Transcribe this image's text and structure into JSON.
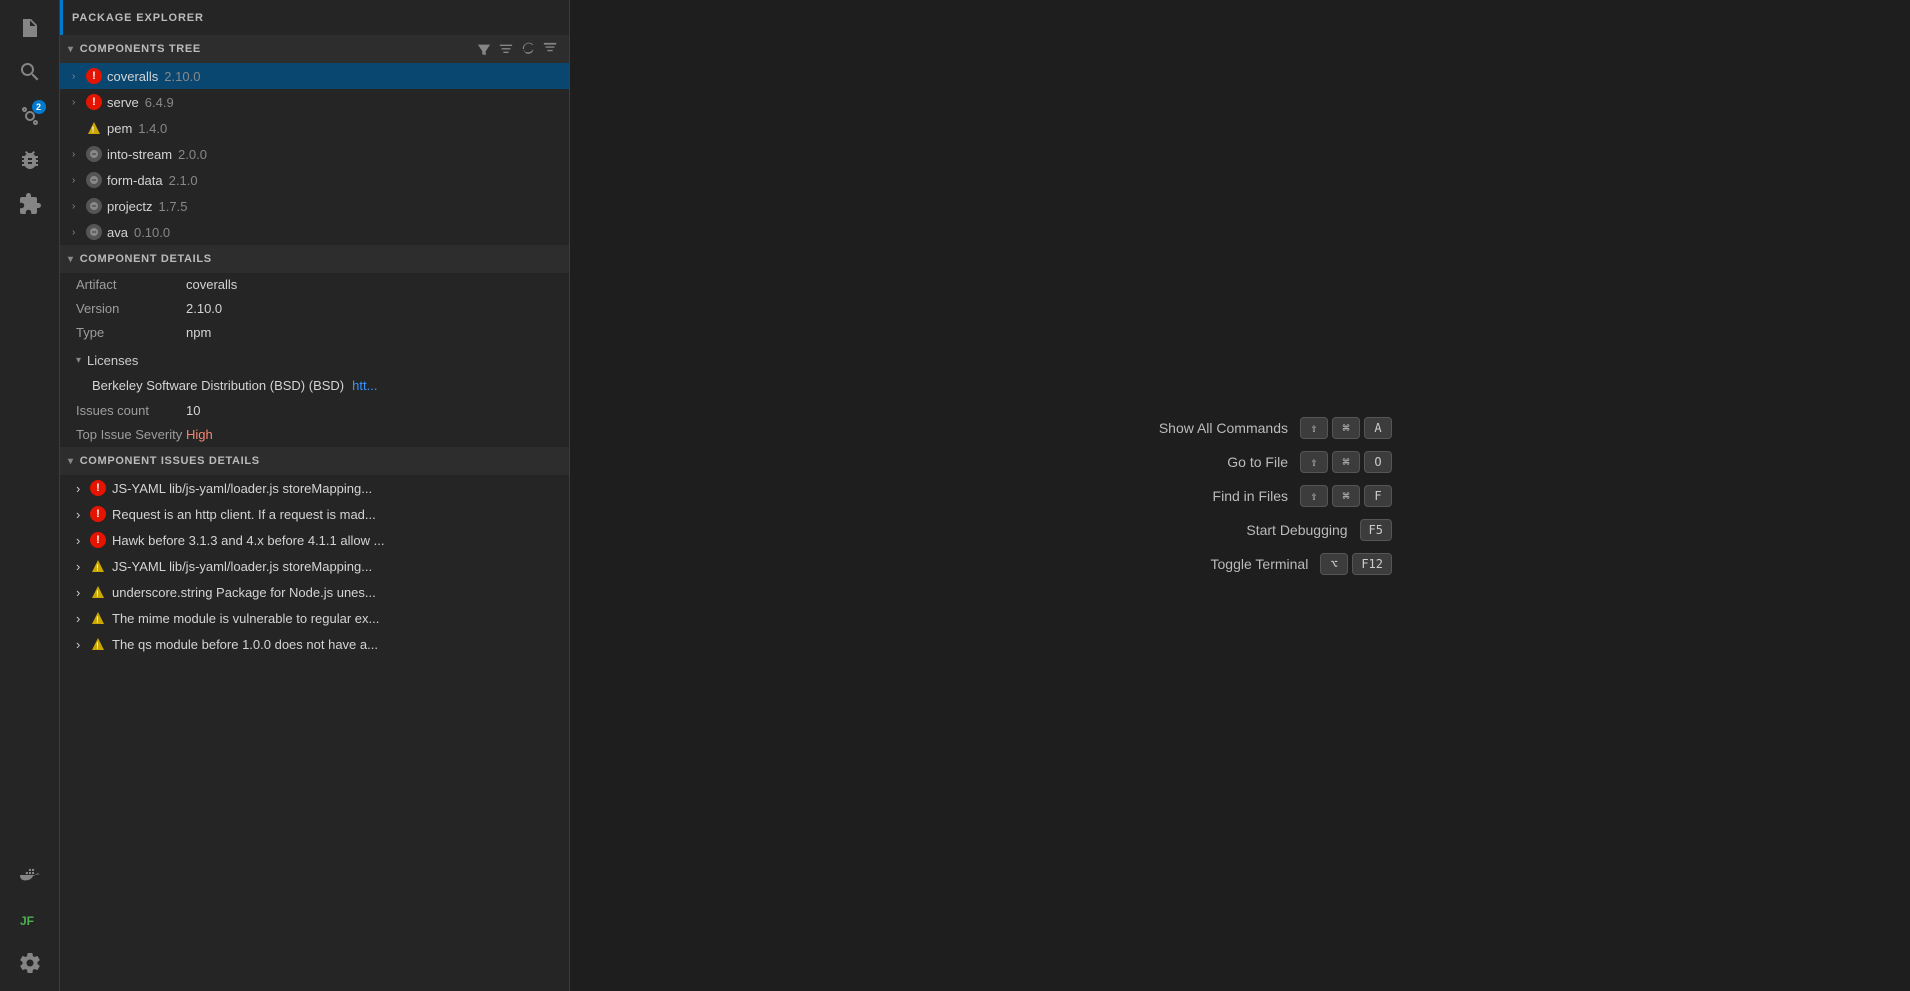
{
  "panel": {
    "title": "PACKAGE EXPLORER"
  },
  "components_tree": {
    "section_label": "COMPONENTS TREE",
    "items": [
      {
        "name": "coveralls",
        "version": "2.10.0",
        "status": "error",
        "has_children": true,
        "selected": true
      },
      {
        "name": "serve",
        "version": "6.4.9",
        "status": "error",
        "has_children": true,
        "selected": false
      },
      {
        "name": "pem",
        "version": "1.4.0",
        "status": "warning",
        "has_children": false,
        "selected": false
      },
      {
        "name": "into-stream",
        "version": "2.0.0",
        "status": "neutral",
        "has_children": true,
        "selected": false
      },
      {
        "name": "form-data",
        "version": "2.1.0",
        "status": "neutral",
        "has_children": true,
        "selected": false
      },
      {
        "name": "projectz",
        "version": "1.7.5",
        "status": "neutral",
        "has_children": true,
        "selected": false
      },
      {
        "name": "ava",
        "version": "0.10.0",
        "status": "neutral",
        "has_children": true,
        "selected": false
      }
    ]
  },
  "component_details": {
    "section_label": "COMPONENT DETAILS",
    "artifact_label": "Artifact",
    "artifact_value": "coveralls",
    "version_label": "Version",
    "version_value": "2.10.0",
    "type_label": "Type",
    "type_value": "npm",
    "licenses_label": "Licenses",
    "licenses": [
      {
        "name": "Berkeley Software Distribution (BSD) (BSD)",
        "link": "htt..."
      }
    ],
    "issues_count_label": "Issues count",
    "issues_count_value": "10",
    "top_issue_label": "Top Issue Severity",
    "top_issue_value": "High"
  },
  "component_issues": {
    "section_label": "COMPONENT ISSUES DETAILS",
    "items": [
      {
        "severity": "error",
        "text": "JS-YAML lib/js-yaml/loader.js storeMapping..."
      },
      {
        "severity": "error",
        "text": "Request is an http client. If a request is mad..."
      },
      {
        "severity": "error",
        "text": "Hawk before 3.1.3 and 4.x before 4.1.1 allow ..."
      },
      {
        "severity": "warning",
        "text": "JS-YAML lib/js-yaml/loader.js storeMapping..."
      },
      {
        "severity": "warning",
        "text": "underscore.string Package for Node.js unes..."
      },
      {
        "severity": "warning",
        "text": "The mime module is vulnerable to regular ex..."
      },
      {
        "severity": "warning",
        "text": "The qs module before 1.0.0 does not have a..."
      }
    ]
  },
  "main_area": {
    "commands": [
      {
        "label": "Show All Commands",
        "keys": [
          "⇧",
          "⌘",
          "A"
        ]
      },
      {
        "label": "Go to File",
        "keys": [
          "⇧",
          "⌘",
          "O"
        ]
      },
      {
        "label": "Find in Files",
        "keys": [
          "⇧",
          "⌘",
          "F"
        ]
      },
      {
        "label": "Start Debugging",
        "keys": [
          "F5"
        ]
      },
      {
        "label": "Toggle Terminal",
        "keys": [
          "⌥",
          "F12"
        ]
      }
    ]
  },
  "activity_bar": {
    "icons": [
      {
        "name": "files-icon",
        "label": "Explorer"
      },
      {
        "name": "search-icon",
        "label": "Search"
      },
      {
        "name": "source-control-icon",
        "label": "Source Control",
        "badge": "2"
      },
      {
        "name": "debug-icon",
        "label": "Run and Debug"
      },
      {
        "name": "extensions-icon",
        "label": "Extensions"
      },
      {
        "name": "docker-icon",
        "label": "Docker"
      },
      {
        "name": "jfrog-icon",
        "label": "JFrog"
      }
    ],
    "bottom_icons": [
      {
        "name": "settings-icon",
        "label": "Settings"
      }
    ]
  }
}
